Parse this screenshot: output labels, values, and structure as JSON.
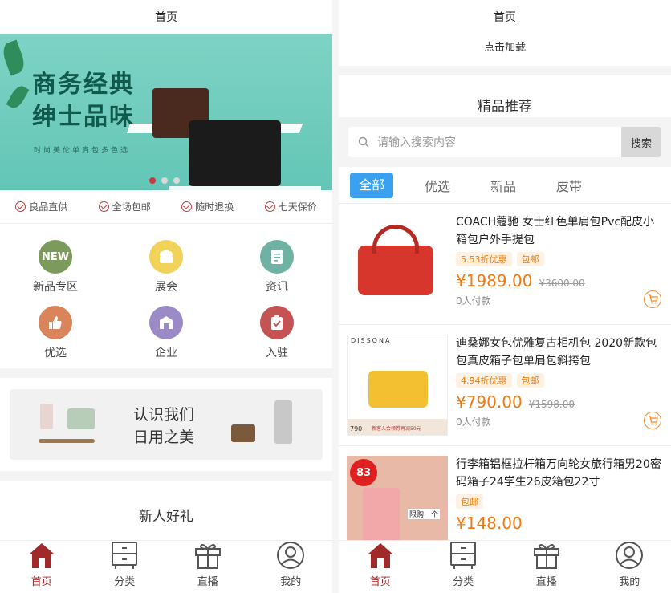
{
  "left": {
    "title": "首页",
    "banner": {
      "headline_1": "商务经典",
      "headline_2": "绅士品味",
      "subtitle": "时尚美伦单肩包多色选"
    },
    "features": [
      "良品直供",
      "全场包邮",
      "随时退换",
      "七天保价"
    ],
    "grid": [
      {
        "label": "新品专区",
        "icon": "new-badge-icon",
        "text": "NEW",
        "color": "#7c9a5b"
      },
      {
        "label": "展会",
        "icon": "cake-icon",
        "text": "",
        "color": "#f1d25b"
      },
      {
        "label": "资讯",
        "icon": "document-icon",
        "text": "",
        "color": "#6fb2a3"
      },
      {
        "label": "优选",
        "icon": "thumbs-up-icon",
        "text": "",
        "color": "#d9845a"
      },
      {
        "label": "企业",
        "icon": "building-icon",
        "text": "",
        "color": "#9b8ac6"
      },
      {
        "label": "入驻",
        "icon": "clipboard-check-icon",
        "text": "",
        "color": "#c65353"
      }
    ],
    "promo": {
      "line_1": "认识我们",
      "line_2": "日用之美"
    },
    "section_title": "新人好礼"
  },
  "right": {
    "title": "首页",
    "load_more": "点击加载",
    "featured_title": "精品推荐",
    "search": {
      "placeholder": "请输入搜索内容",
      "button": "搜索"
    },
    "categories": [
      "全部",
      "优选",
      "新品",
      "皮带"
    ],
    "products": [
      {
        "title": "COACH蔻驰 女士红色单肩包Pvc配皮小箱包户外手提包",
        "discount": "5.53折优惠",
        "shipping": "包邮",
        "price": "¥1989.00",
        "original": "¥3600.00",
        "paid": "0人付款"
      },
      {
        "title": "迪桑娜女包优雅复古相机包 2020新款包包真皮箱子包单肩包斜挎包",
        "discount": "4.94折优惠",
        "shipping": "包邮",
        "price": "¥790.00",
        "original": "¥1598.00",
        "paid": "0人付款",
        "brand": "DISSONA",
        "badge_price": "790",
        "badge_note": "新客入会领券再减50元"
      },
      {
        "title": "行李箱铝框拉杆箱万向轮女旅行箱男20密码箱子24学生26皮箱包22寸",
        "discount": "",
        "shipping": "包邮",
        "price": "¥148.00",
        "original": "",
        "paid": "",
        "badge": "83",
        "badge_note": "限购一个"
      }
    ]
  },
  "tabbar": [
    {
      "label": "首页",
      "icon": "home-icon"
    },
    {
      "label": "分类",
      "icon": "cabinet-icon"
    },
    {
      "label": "直播",
      "icon": "gift-icon"
    },
    {
      "label": "我的",
      "icon": "user-icon"
    }
  ],
  "colors": {
    "accent": "#9e2a2a",
    "price": "#f07a10",
    "tab_active_bg": "#3aa0f0"
  }
}
